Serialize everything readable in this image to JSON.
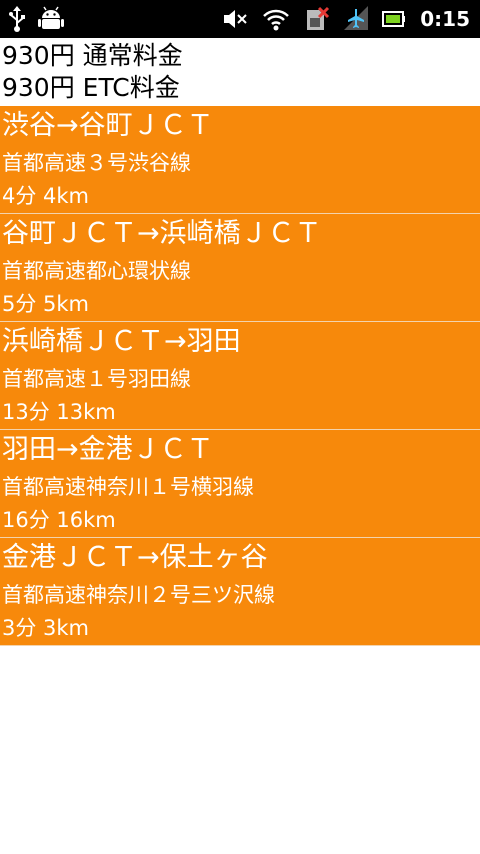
{
  "status_bar": {
    "left_icons": [
      "usb-icon",
      "android-debug-icon"
    ],
    "right_icons": [
      "mute-icon",
      "wifi-icon",
      "sim-error-icon",
      "signal-airplane-icon",
      "battery-icon"
    ],
    "time": "0:15",
    "colors": {
      "background": "#000000",
      "icon": "#ffffff",
      "battery": "#7ed320",
      "sim_error": "#e53935"
    }
  },
  "fare": {
    "normal": "930円 通常料金",
    "etc": "930円 ETC料金"
  },
  "route_color": "#f7890b",
  "routes": [
    {
      "segment": "渋谷→谷町ＪＣＴ",
      "road": "首都高速３号渋谷線",
      "time_distance": "4分 4km"
    },
    {
      "segment": "谷町ＪＣＴ→浜崎橋ＪＣＴ",
      "road": "首都高速都心環状線",
      "time_distance": "5分 5km"
    },
    {
      "segment": "浜崎橋ＪＣＴ→羽田",
      "road": "首都高速１号羽田線",
      "time_distance": "13分 13km"
    },
    {
      "segment": "羽田→金港ＪＣＴ",
      "road": "首都高速神奈川１号横羽線",
      "time_distance": "16分 16km"
    },
    {
      "segment": "金港ＪＣＴ→保土ヶ谷",
      "road": "首都高速神奈川２号三ツ沢線",
      "time_distance": "3分 3km"
    }
  ]
}
